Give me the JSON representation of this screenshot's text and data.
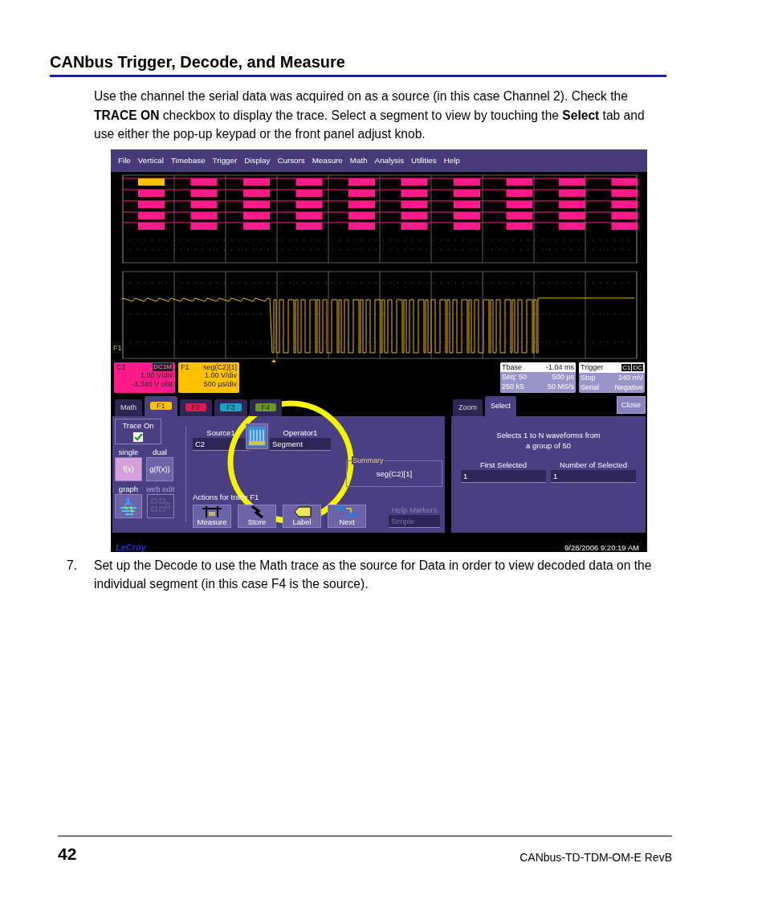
{
  "heading": "CANbus Trigger, Decode, and Measure",
  "intro": "Use the channel the serial data was acquired on as a source (in this case Channel 2). Check the **TRACE ON** checkbox to display the trace. Select a segment to view by touching the **Select** tab and use either the pop-up keypad or the front panel adjust knob.",
  "screenshot": {
    "menu": [
      "File",
      "Vertical",
      "Timebase",
      "Trigger",
      "Display",
      "Cursors",
      "Measure",
      "Math",
      "Analysis",
      "Utilities",
      "Help"
    ],
    "trace_label": "F1",
    "descriptors": [
      {
        "name": "C2",
        "badge": "DC1M",
        "lines": [
          "1.00 V/div",
          "-3.340 V ofst"
        ],
        "color": "#ff1a8c"
      },
      {
        "name": "F1",
        "title": "seg(C2)[1]",
        "lines": [
          "1.00 V/div",
          "500 µs/div"
        ],
        "color": "#ffc000"
      }
    ],
    "tbase": {
      "rows": [
        [
          "Tbase",
          "-1.04 ms"
        ],
        [
          "Seq: 50",
          "500 µs"
        ],
        [
          "250 kS",
          "50 MS/s"
        ]
      ]
    },
    "trigger": {
      "label": "Trigger",
      "badges": [
        "C1",
        "DC"
      ],
      "rows": [
        [
          "Stop",
          "240 mV"
        ],
        [
          "Serial",
          "Negative"
        ]
      ]
    },
    "math_tabs": [
      {
        "label": "Math",
        "selected": false
      },
      {
        "label": "F1",
        "selected": true,
        "color": "#ffc000"
      },
      {
        "label": "F2",
        "selected": false,
        "color": "#e8184f"
      },
      {
        "label": "F3",
        "selected": false,
        "color": "#1aa3c8"
      },
      {
        "label": "F4",
        "selected": false,
        "color": "#6a9a20"
      }
    ],
    "trace_on": {
      "label": "Trace On",
      "checked": true
    },
    "modes": [
      {
        "label": "single",
        "button": "f(x)",
        "selected": true
      },
      {
        "label": "dual",
        "button": "g(f(x))",
        "selected": false
      }
    ],
    "editors": [
      {
        "label": "graph",
        "disabled": false
      },
      {
        "label": "web edit",
        "disabled": true
      }
    ],
    "source": {
      "label": "Source1",
      "value": "C2"
    },
    "operator": {
      "label": "Operator1",
      "value": "Segment"
    },
    "summary": {
      "label": "Summary",
      "value": "seg(C2)[1]"
    },
    "actions_label": "Actions for trace F1",
    "actions": [
      {
        "kind": "measure",
        "label": "Measure"
      },
      {
        "kind": "store",
        "label": "Store"
      },
      {
        "kind": "label",
        "label": "Label"
      },
      {
        "kind": "next",
        "label": "Next"
      }
    ],
    "help_markers": {
      "label": "Help Markers",
      "value": "Simple",
      "disabled": true
    },
    "right_tabs": [
      {
        "label": "Zoom",
        "selected": false
      },
      {
        "label": "Select",
        "selected": true
      }
    ],
    "close": "Close",
    "select_info": [
      "Selects 1 to N waveforms from",
      "a group of 50"
    ],
    "first_selected": {
      "label": "First Selected",
      "value": "1"
    },
    "number_selected": {
      "label": "Number of Selected",
      "value": "1"
    },
    "brand": "LeCroy",
    "timestamp": "9/28/2006 9:20:19 AM"
  },
  "step": {
    "number": "7.",
    "text": "Set up the Decode to use the Math trace as the source for Data in order to view decoded data on the individual segment (in this case F4 is the source)."
  },
  "footer": {
    "page": "42",
    "doc": "CANbus-TD-TDM-OM-E RevB"
  }
}
